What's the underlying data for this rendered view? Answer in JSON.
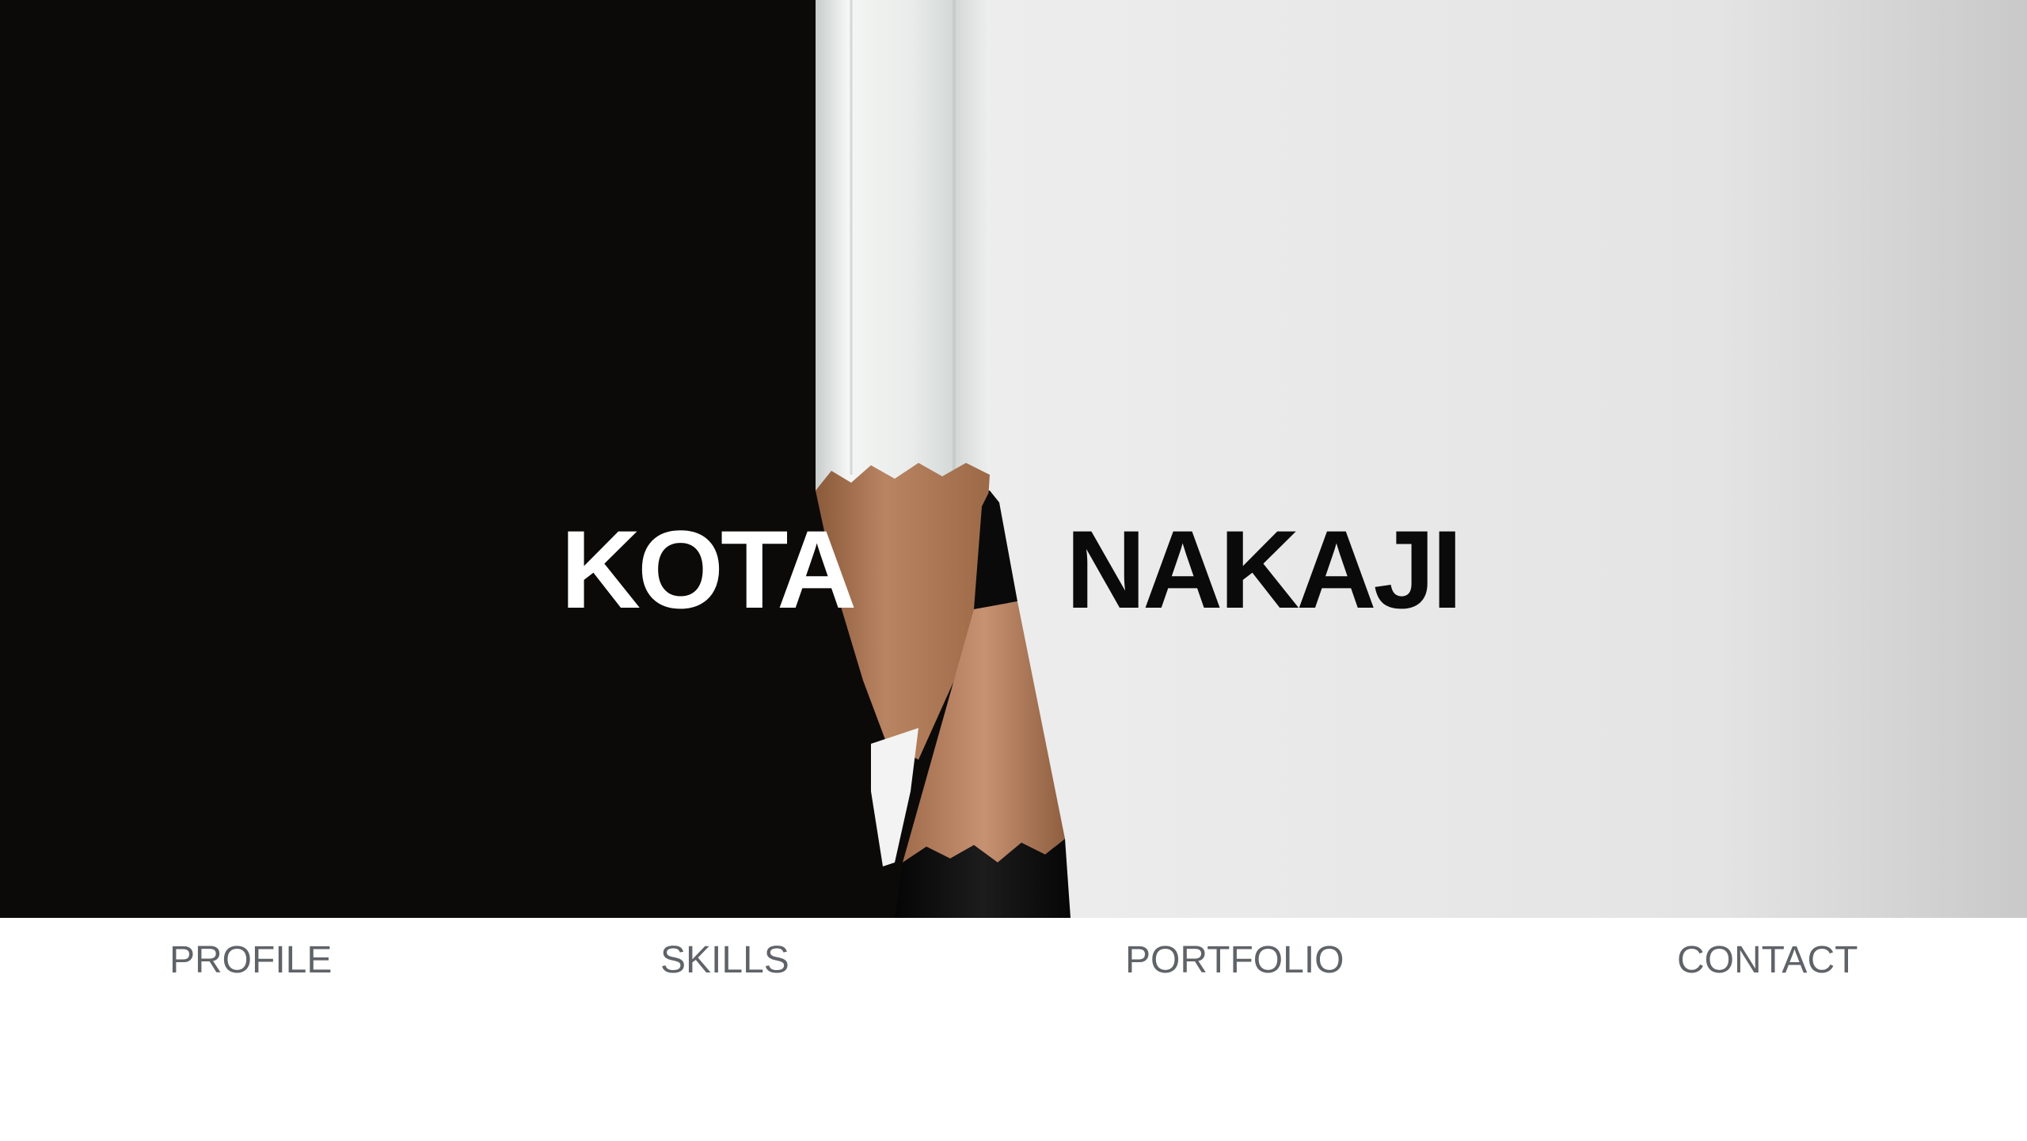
{
  "hero": {
    "first_name": "KOTA",
    "last_name": "NAKAJI",
    "image_subject": "two-pencils-black-white"
  },
  "nav": {
    "items": [
      {
        "label": "PROFILE"
      },
      {
        "label": "SKILLS"
      },
      {
        "label": "PORTFOLIO"
      },
      {
        "label": "CONTACT"
      }
    ]
  },
  "colors": {
    "dark_bg": "#0c0a09",
    "light_bg": "#e6e6e6",
    "title_light": "#ffffff",
    "title_dark": "#0a0a0a",
    "nav_text": "#5f6368",
    "wood": "#b07a55"
  }
}
